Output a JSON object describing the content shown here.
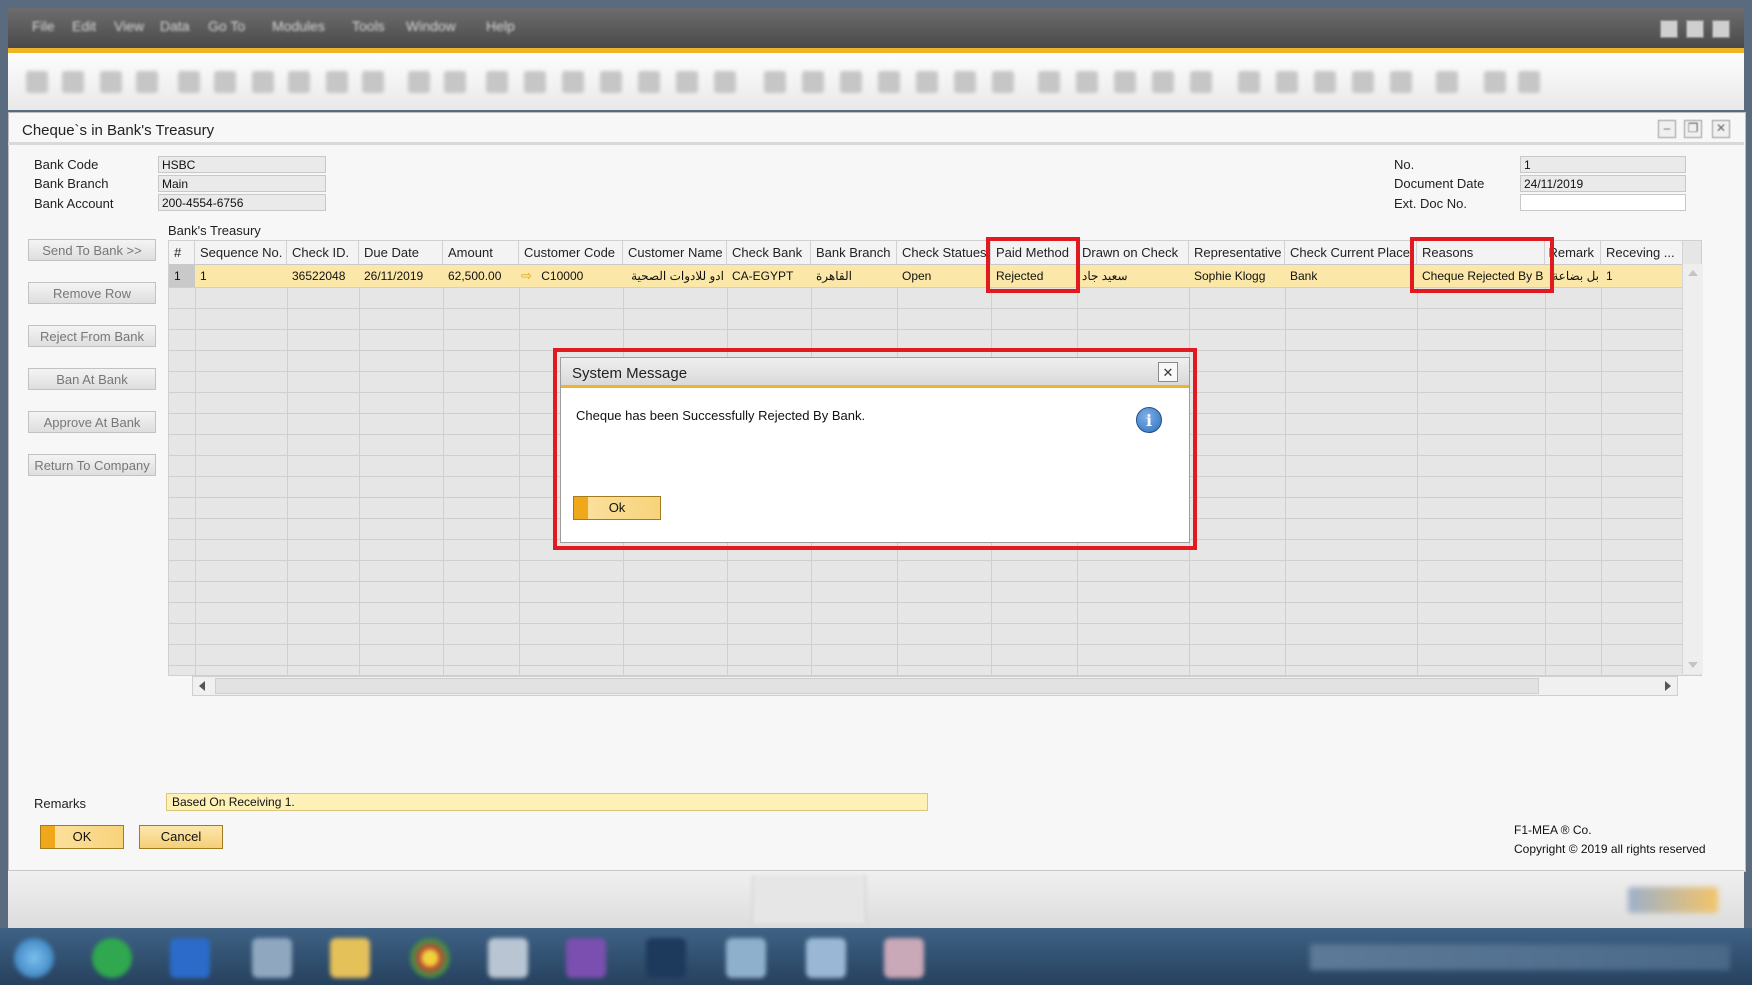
{
  "menu": [
    "File",
    "Edit",
    "View",
    "Data",
    "Go To",
    "Modules",
    "Tools",
    "Window",
    "Help"
  ],
  "form": {
    "title": "Cheque`s in Bank's Treasury",
    "bank_code_label": "Bank Code",
    "bank_code": "HSBC",
    "bank_branch_label": "Bank Branch",
    "bank_branch": "Main",
    "bank_account_label": "Bank Account",
    "bank_account": "200-4554-6756",
    "no_label": "No.",
    "no": "1",
    "doc_date_label": "Document Date",
    "doc_date": "24/11/2019",
    "ext_doc_label": "Ext. Doc No.",
    "ext_doc": ""
  },
  "side_buttons": [
    "Send To Bank >>",
    "Remove Row",
    "Reject From Bank",
    "Ban At Bank",
    "Approve At Bank",
    "Return To Company"
  ],
  "grid": {
    "caption": "Bank's Treasury",
    "headers": [
      "#",
      "Sequence No.",
      "Check ID.",
      "Due Date",
      "Amount",
      "Customer Code",
      "Customer Name",
      "Check Bank",
      "Bank Branch",
      "Check Statues",
      "Paid Method",
      "Drawn on Check",
      "Representative",
      "Check Current Place",
      "Reasons",
      "Remark",
      "Receving ..."
    ],
    "row": [
      "1",
      "1",
      "36522048",
      "26/11/2019",
      "62,500.00",
      "C10000",
      "ادو للادوات الصحية",
      "CA-EGYPT",
      "القاهرة",
      "Open",
      "Rejected",
      "سعيد جاد",
      "Sophie Klogg",
      "Bank",
      "Cheque Rejected By B",
      "بل بضاعة",
      "1"
    ]
  },
  "dialog": {
    "title": "System Message",
    "message": "Cheque has been Successfully Rejected By Bank.",
    "ok": "Ok",
    "close": "✕",
    "info": "i"
  },
  "remarks": {
    "label": "Remarks",
    "value": "Based On Receiving 1."
  },
  "buttons": {
    "ok": "OK",
    "cancel": "Cancel"
  },
  "copyright": {
    "line1": "F1-MEA ® Co.",
    "line2": "Copyright © 2019 all rights reserved"
  },
  "colors": {
    "accent": "#f0b429",
    "selected_row": "#fbe7a7",
    "highlight": "#e11a22",
    "info": "#2f6fb8"
  }
}
